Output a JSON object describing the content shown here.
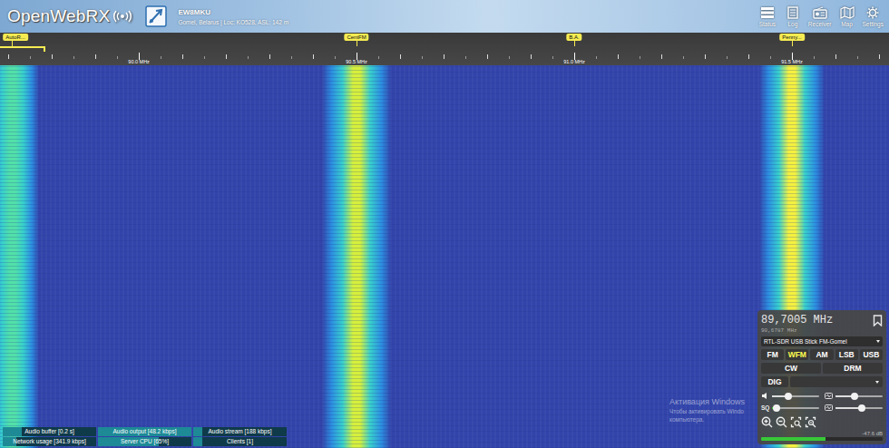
{
  "header": {
    "logo": "OpenWebRX",
    "callsign": "EW8MKU",
    "location": "Gomel, Belarus | Loc: KO528, ASL: 142 m",
    "nav": [
      {
        "label": "Status"
      },
      {
        "label": "Log"
      },
      {
        "label": "Receiver"
      },
      {
        "label": "Map"
      },
      {
        "label": "Settings"
      }
    ]
  },
  "scale": {
    "start_mhz": 89.681,
    "end_mhz": 91.723,
    "ticks": [
      {
        "label": "90.0 MHz",
        "freq": 90.0
      },
      {
        "label": "90.5 MHz",
        "freq": 90.5
      },
      {
        "label": "91.0 MHz",
        "freq": 91.0
      },
      {
        "label": "91.5 MHz",
        "freq": 91.5
      }
    ],
    "passband": {
      "low": 89.62,
      "high": 89.785
    },
    "bookmarks": [
      {
        "label": "AutoR...",
        "freq": 89.708
      },
      {
        "label": "CentFM",
        "freq": 90.5
      },
      {
        "label": "B.A.",
        "freq": 91.0
      },
      {
        "label": "Penny...",
        "freq": 91.5
      }
    ]
  },
  "waterfall": {
    "signals": [
      {
        "freq": 89.71,
        "width": 0.12,
        "level": 0.6
      },
      {
        "freq": 90.5,
        "width": 0.16,
        "level": 0.85
      },
      {
        "freq": 91.5,
        "width": 0.15,
        "level": 1.0
      }
    ]
  },
  "status_bar": [
    {
      "label": "Audio buffer [0.2 s]",
      "level": 0.2
    },
    {
      "label": "Audio output [48.2 kbps]",
      "level": 1.0
    },
    {
      "label": "Audio stream [188 kbps]",
      "level": 0.1
    },
    {
      "label": "Network usage [341.9 kbps]",
      "level": 0.15
    },
    {
      "label": "Server CPU [65%]",
      "level": 0.65
    },
    {
      "label": "Clients [1]",
      "level": 0.1
    }
  ],
  "watermark": {
    "lines": [
      "Активация Windows",
      "Чтобы активировать Windo",
      "компьютера."
    ]
  },
  "receiver": {
    "frequency": "89,7005 MHz",
    "offset_frequency": "90,6787 MHz",
    "profile": "RTL-SDR USB Stick FM-Gomel",
    "mode_rows": [
      [
        {
          "label": "FM",
          "selected": false
        },
        {
          "label": "WFM",
          "selected": true
        },
        {
          "label": "AM",
          "selected": false
        },
        {
          "label": "LSB",
          "selected": false
        },
        {
          "label": "USB",
          "selected": false
        }
      ],
      [
        {
          "label": "CW",
          "selected": false
        },
        {
          "label": "DRM",
          "selected": false
        }
      ]
    ],
    "digital": {
      "label": "DIG",
      "selected": false
    },
    "sliders": [
      {
        "kind": "volume",
        "level": 0.35
      },
      {
        "kind": "noise",
        "level": 0.4
      },
      {
        "kind": "squelch",
        "label": "SQ",
        "level": 0.08
      },
      {
        "kind": "noise",
        "level": 0.55
      }
    ],
    "meter": {
      "level": 0.53,
      "reading": "-47.6 dB"
    }
  }
}
